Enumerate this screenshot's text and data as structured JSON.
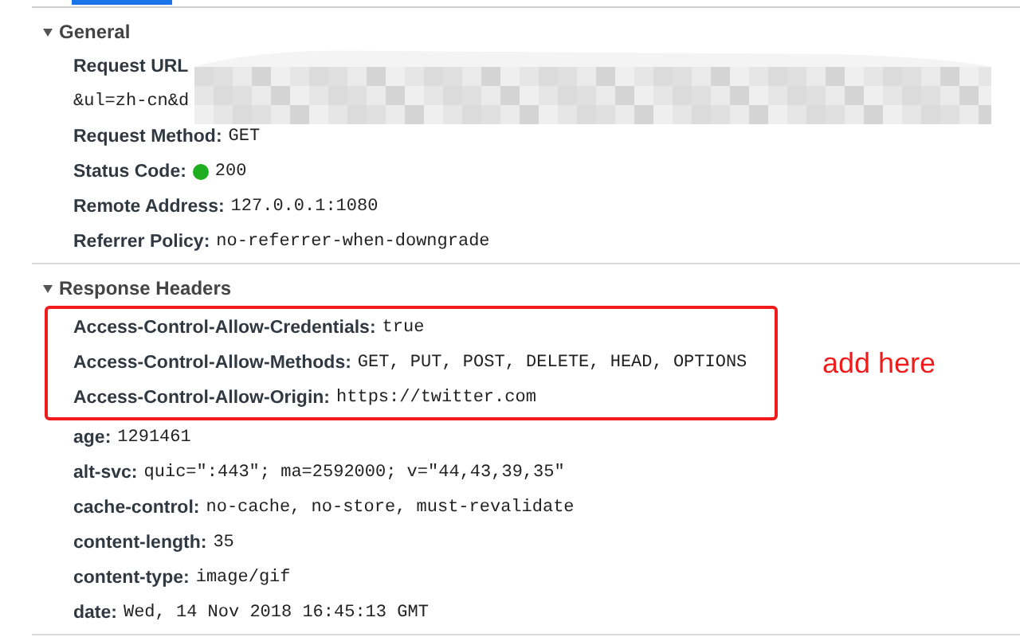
{
  "sections": [
    {
      "title": "General",
      "expanded": true,
      "rows": [
        {
          "kind": "url",
          "name": "Request URL",
          "continuation": "&ul=zh-cn&d"
        },
        {
          "kind": "plain",
          "name": "Request Method:",
          "value": "GET"
        },
        {
          "kind": "status",
          "name": "Status Code:",
          "value": "200",
          "color": "#1fae1f"
        },
        {
          "kind": "plain",
          "name": "Remote Address:",
          "value": "127.0.0.1:1080"
        },
        {
          "kind": "plain",
          "name": "Referrer Policy:",
          "value": "no-referrer-when-downgrade"
        }
      ]
    },
    {
      "title": "Response Headers",
      "expanded": true,
      "annotation": "add here",
      "highlighted_rows": [
        {
          "name": "Access-Control-Allow-Credentials:",
          "value": "true"
        },
        {
          "name": "Access-Control-Allow-Methods:",
          "value": "GET, PUT, POST, DELETE, HEAD, OPTIONS"
        },
        {
          "name": "Access-Control-Allow-Origin:",
          "value": "https://twitter.com"
        }
      ],
      "rows": [
        {
          "kind": "plain",
          "name": "age:",
          "value": "1291461"
        },
        {
          "kind": "plain",
          "name": "alt-svc:",
          "value": "quic=\":443\"; ma=2592000; v=\"44,43,39,35\""
        },
        {
          "kind": "plain",
          "name": "cache-control:",
          "value": "no-cache, no-store, must-revalidate"
        },
        {
          "kind": "plain",
          "name": "content-length:",
          "value": "35"
        },
        {
          "kind": "plain",
          "name": "content-type:",
          "value": "image/gif"
        },
        {
          "kind": "plain",
          "name": "date:",
          "value": "Wed, 14 Nov 2018 16:45:13 GMT"
        }
      ]
    }
  ]
}
